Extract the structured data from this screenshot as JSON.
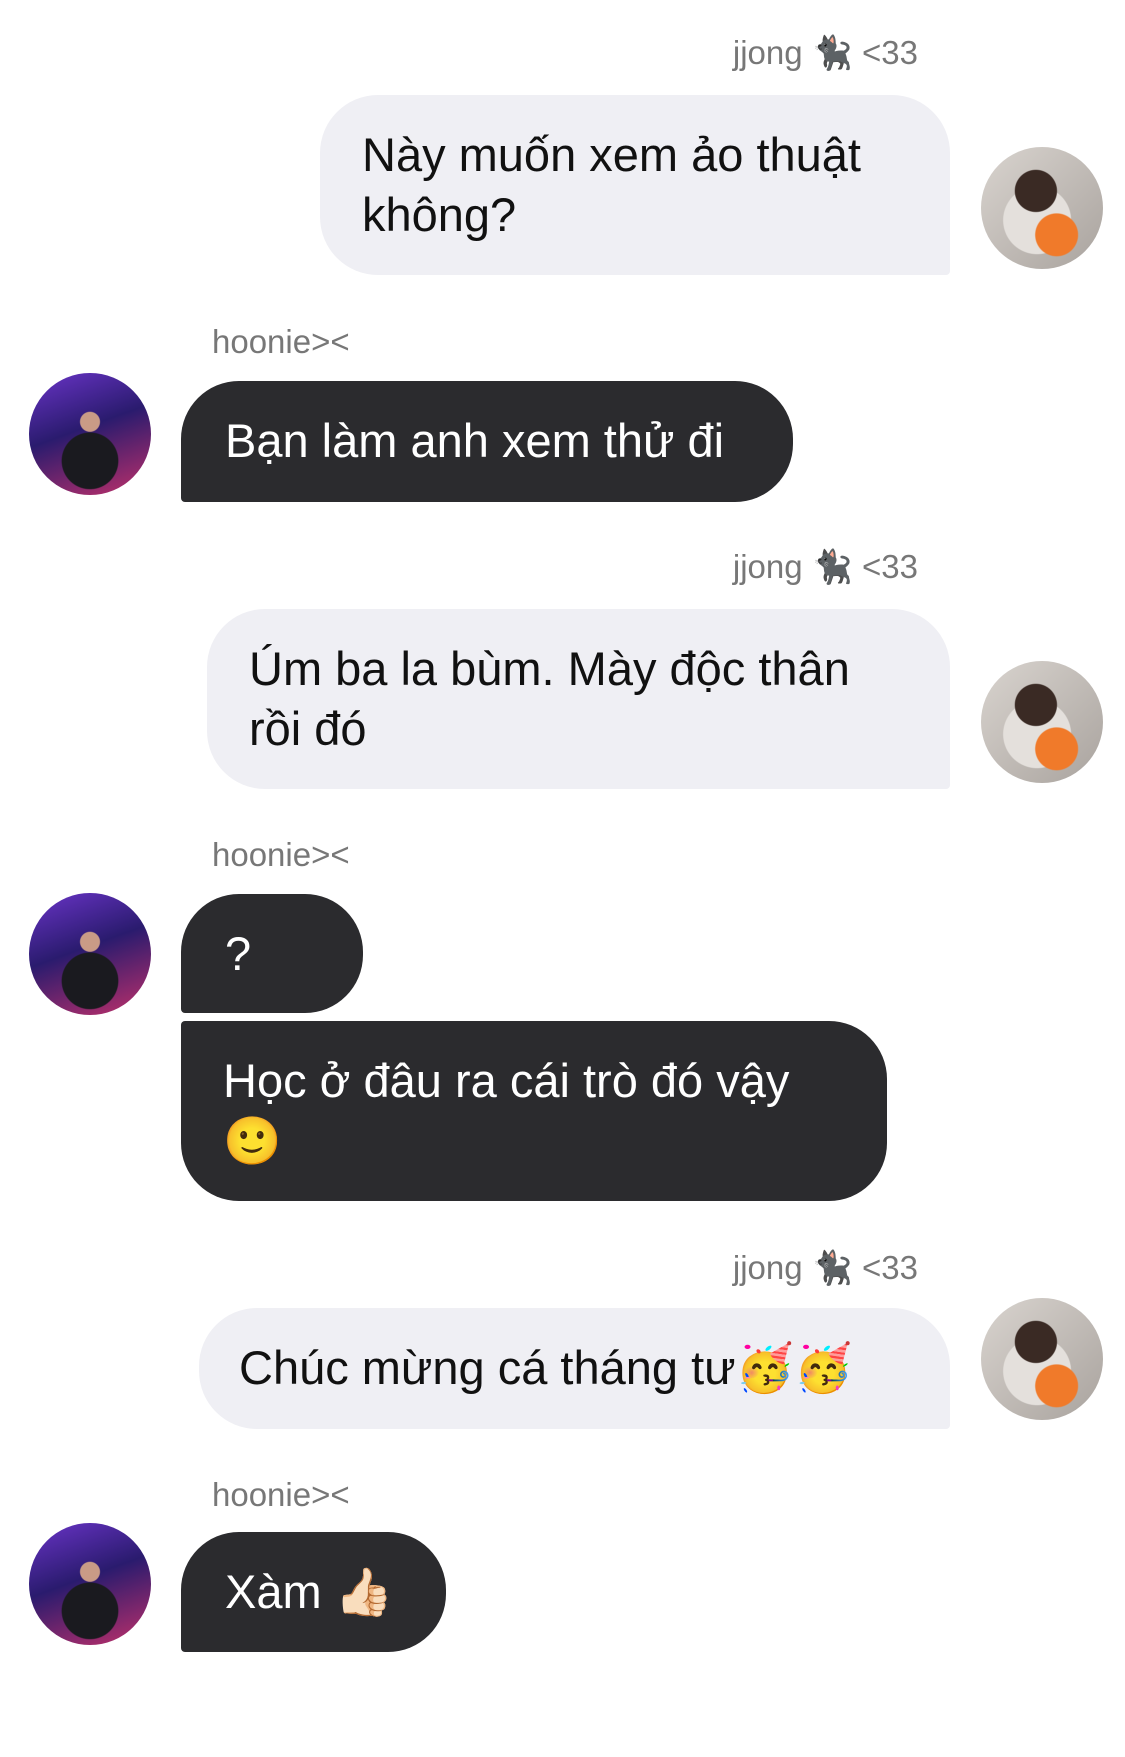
{
  "messages": [
    {
      "sender": "jjong 🐈‍⬛ <33",
      "lines": [
        "Này muốn xem ảo thuật",
        "không?"
      ]
    },
    {
      "sender": "hoonie><",
      "lines": [
        "Bạn làm anh xem thử đi"
      ]
    },
    {
      "sender": "jjong 🐈‍⬛ <33",
      "lines": [
        "Úm ba la bùm. Mày độc thân",
        "rồi đó"
      ]
    },
    {
      "sender": "hoonie><",
      "lines": [
        "?"
      ]
    },
    {
      "sender": "hoonie><",
      "lines": [
        "Học ở đâu ra cái trò đó vậy",
        "🙂"
      ]
    },
    {
      "sender": "jjong 🐈‍⬛ <33",
      "lines": [
        "Chúc mừng cá tháng tư🥳🥳"
      ]
    },
    {
      "sender": "hoonie><",
      "lines": [
        "Xàm 👍🏻"
      ]
    }
  ],
  "labels": {
    "jjong": "jjong 🐈‍⬛ <33",
    "hoonie": "hoonie><"
  },
  "text": {
    "m1": "Này muốn xem ảo thuật\nkhông?",
    "m2": "Bạn làm anh xem thử đi",
    "m3": "Úm ba la bùm. Mày độc thân\nrồi đó",
    "m4": "?",
    "m5": "Học ở đâu ra cái trò đó vậy\n🙂",
    "m6": "Chúc mừng cá tháng tư🥳🥳",
    "m7": "Xàm 👍🏻"
  },
  "colors": {
    "outgoing_bubble": "#efeff4",
    "incoming_bubble": "#2b2b2e",
    "sender_name": "#777777"
  }
}
